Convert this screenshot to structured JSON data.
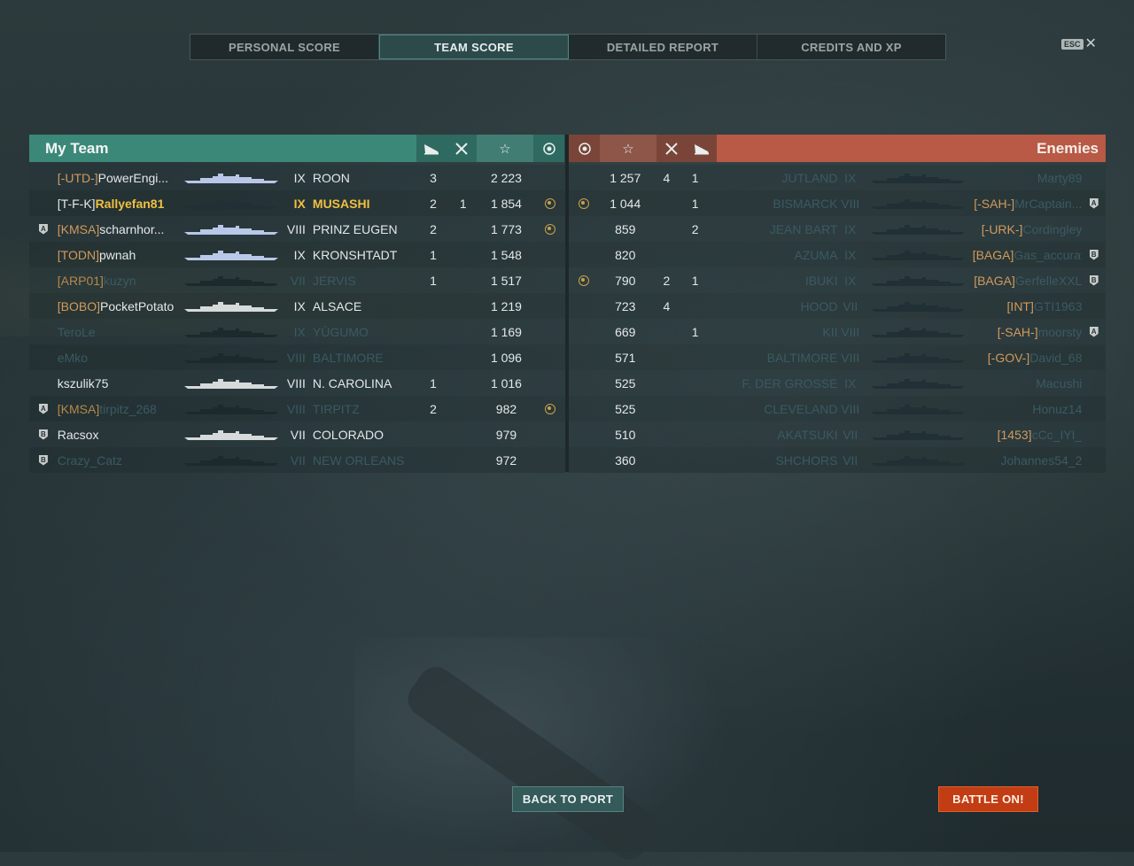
{
  "tabs": [
    {
      "label": "PERSONAL SCORE"
    },
    {
      "label": "TEAM SCORE"
    },
    {
      "label": "DETAILED REPORT"
    },
    {
      "label": "CREDITS AND XP"
    }
  ],
  "esc": {
    "key": "ESC",
    "close": "✕"
  },
  "my_team": {
    "title": "My Team",
    "header_icons": [
      "plane-kills-icon",
      "ship-kills-icon",
      "score-star-icon",
      "base-capture-icon"
    ],
    "rows": [
      {
        "div": "",
        "clan": "[-UTD-]",
        "name": "PowerEngi...",
        "tier": "IX",
        "ship": "ROON",
        "planes": "3",
        "kills": "",
        "score": "2 223",
        "cap": false,
        "state": "alive",
        "sil": "blue"
      },
      {
        "div": "",
        "clan": "[T-F-K]",
        "name": "Rallyefan81",
        "tier": "IX",
        "ship": "MUSASHI",
        "planes": "2",
        "kills": "1",
        "score": "1 854",
        "cap": true,
        "state": "me",
        "sil": "dark"
      },
      {
        "div": "A",
        "clan": "[KMSA]",
        "name": "scharnhor...",
        "tier": "VIII",
        "ship": "PRINZ EUGEN",
        "planes": "2",
        "kills": "",
        "score": "1 773",
        "cap": true,
        "state": "alive",
        "sil": "blue"
      },
      {
        "div": "",
        "clan": "[TODN]",
        "name": "pwnah",
        "tier": "IX",
        "ship": "KRONSHTADT",
        "planes": "1",
        "kills": "",
        "score": "1 548",
        "cap": false,
        "state": "alive",
        "sil": "blue"
      },
      {
        "div": "",
        "clan": "[ARP01]",
        "name": "kuzyn",
        "tier": "VII",
        "ship": "JERVIS",
        "planes": "1",
        "kills": "",
        "score": "1 517",
        "cap": false,
        "state": "dead",
        "sil": "dark"
      },
      {
        "div": "",
        "clan": "[BOBO]",
        "name": "PocketPotato",
        "tier": "IX",
        "ship": "ALSACE",
        "planes": "",
        "kills": "",
        "score": "1 219",
        "cap": false,
        "state": "alive",
        "sil": "white"
      },
      {
        "div": "",
        "clan": "",
        "name": "TeroLe",
        "tier": "IX",
        "ship": "YŪGUMO",
        "planes": "",
        "kills": "",
        "score": "1 169",
        "cap": false,
        "state": "dead",
        "sil": "dark"
      },
      {
        "div": "",
        "clan": "",
        "name": "eMko",
        "tier": "VIII",
        "ship": "BALTIMORE",
        "planes": "",
        "kills": "",
        "score": "1 096",
        "cap": false,
        "state": "dead",
        "sil": "dark"
      },
      {
        "div": "",
        "clan": "",
        "name": "kszulik75",
        "tier": "VIII",
        "ship": "N. CAROLINA",
        "planes": "1",
        "kills": "",
        "score": "1 016",
        "cap": false,
        "state": "alive",
        "sil": "white"
      },
      {
        "div": "A",
        "clan": "[KMSA]",
        "name": "tirpitz_268",
        "tier": "VIII",
        "ship": "TIRPITZ",
        "planes": "2",
        "kills": "",
        "score": "982",
        "cap": true,
        "state": "dead",
        "sil": "dark"
      },
      {
        "div": "B",
        "clan": "",
        "name": "Racsox",
        "tier": "VII",
        "ship": "COLORADO",
        "planes": "",
        "kills": "",
        "score": "979",
        "cap": false,
        "state": "alive",
        "sil": "white"
      },
      {
        "div": "B",
        "clan": "",
        "name": "Crazy_Catz",
        "tier": "VII",
        "ship": "NEW ORLEANS",
        "planes": "",
        "kills": "",
        "score": "972",
        "cap": false,
        "state": "dead",
        "sil": "dark"
      }
    ]
  },
  "enemies": {
    "title": "Enemies",
    "rows": [
      {
        "cap": false,
        "score": "1 257",
        "kills": "4",
        "planes": "1",
        "ship": "JUTLAND",
        "tier": "IX",
        "clan": "",
        "name": "Marty89",
        "div": ""
      },
      {
        "cap": true,
        "score": "1 044",
        "kills": "",
        "planes": "1",
        "ship": "BISMARCK",
        "tier": "VIII",
        "clan": "[-SAH-]",
        "name": "MrCaptain...",
        "div": "A"
      },
      {
        "cap": false,
        "score": "859",
        "kills": "",
        "planes": "2",
        "ship": "JEAN BART",
        "tier": "IX",
        "clan": "[-URK-]",
        "name": "Cordingley",
        "div": ""
      },
      {
        "cap": false,
        "score": "820",
        "kills": "",
        "planes": "",
        "ship": "AZUMA",
        "tier": "IX",
        "clan": "[BAGA]",
        "name": "Gas_accurate",
        "div": "B"
      },
      {
        "cap": true,
        "score": "790",
        "kills": "2",
        "planes": "1",
        "ship": "IBUKI",
        "tier": "IX",
        "clan": "[BAGA]",
        "name": "GerfelleXXL",
        "div": "B"
      },
      {
        "cap": false,
        "score": "723",
        "kills": "4",
        "planes": "",
        "ship": "HOOD",
        "tier": "VII",
        "clan": "[INT]",
        "name": "GTI1963",
        "div": ""
      },
      {
        "cap": false,
        "score": "669",
        "kills": "",
        "planes": "1",
        "ship": "KII",
        "tier": "VIII",
        "clan": "[-SAH-]",
        "name": "moorsty",
        "div": "A"
      },
      {
        "cap": false,
        "score": "571",
        "kills": "",
        "planes": "",
        "ship": "BALTIMORE",
        "tier": "VIII",
        "clan": "[-GOV-]",
        "name": "David_68",
        "div": ""
      },
      {
        "cap": false,
        "score": "525",
        "kills": "",
        "planes": "",
        "ship": "F. DER GROSSE",
        "tier": "IX",
        "clan": "",
        "name": "Macushi",
        "div": ""
      },
      {
        "cap": false,
        "score": "525",
        "kills": "",
        "planes": "",
        "ship": "CLEVELAND",
        "tier": "VIII",
        "clan": "",
        "name": "Honuz14",
        "div": ""
      },
      {
        "cap": false,
        "score": "510",
        "kills": "",
        "planes": "",
        "ship": "AKATSUKI",
        "tier": "VII",
        "clan": "[1453]",
        "name": "cCc_IYI_",
        "div": ""
      },
      {
        "cap": false,
        "score": "360",
        "kills": "",
        "planes": "",
        "ship": "SHCHORS",
        "tier": "VII",
        "clan": "",
        "name": "Johannes54_2",
        "div": ""
      }
    ]
  },
  "buttons": {
    "back": "BACK TO PORT",
    "battle": "BATTLE ON!"
  },
  "colors": {
    "my_team": "#3b8878",
    "enemies": "#b85a45",
    "me": "#f0c040",
    "clan": "#d19a5c",
    "battle_button": "#c23c14"
  }
}
